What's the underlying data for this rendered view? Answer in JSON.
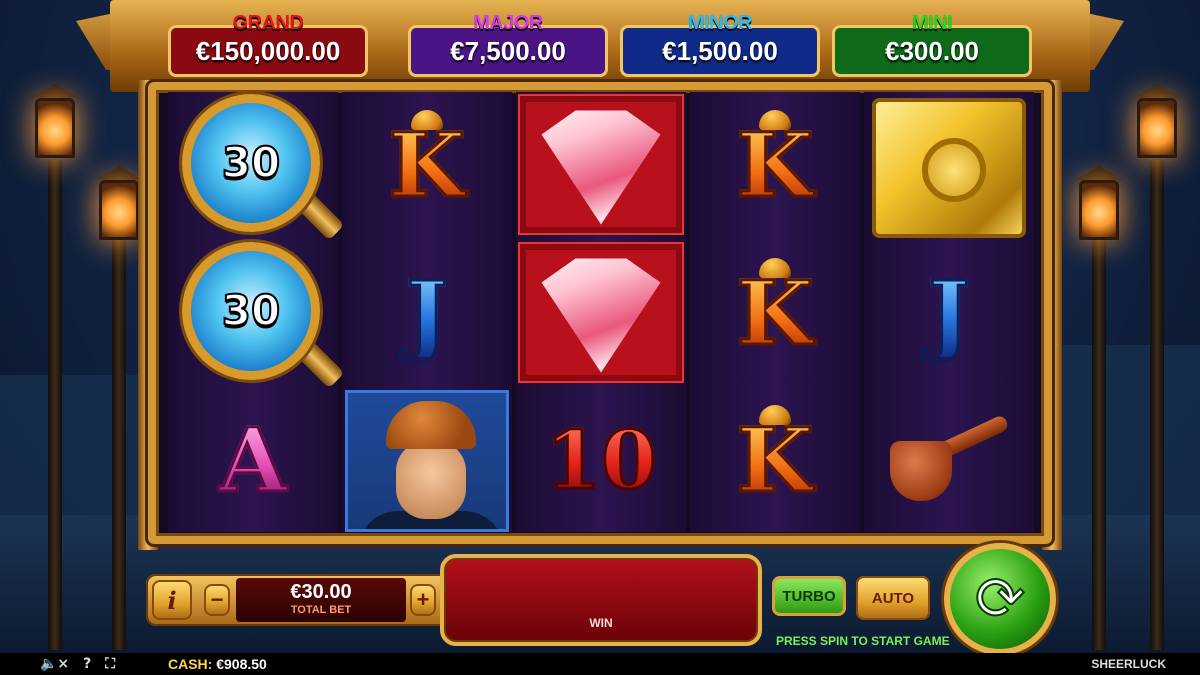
{
  "jackpots": [
    {
      "label": "GRAND",
      "value": "€150,000.00",
      "label_color": "#e4141c",
      "box_color": "#8a0a12"
    },
    {
      "label": "MAJOR",
      "value": "€7,500.00",
      "label_color": "#d33ae8",
      "box_color": "#4a1484"
    },
    {
      "label": "MINOR",
      "value": "€1,500.00",
      "label_color": "#2ab8f0",
      "box_color": "#102a8a"
    },
    {
      "label": "MINI",
      "value": "€300.00",
      "label_color": "#2ad41a",
      "box_color": "#0e6a18"
    }
  ],
  "reels": [
    [
      "magnifier-30",
      "magnifier-30",
      "A"
    ],
    [
      "K",
      "J",
      "detective"
    ],
    [
      "diamond",
      "diamond",
      "10"
    ],
    [
      "K",
      "K",
      "K"
    ],
    [
      "vault",
      "J",
      "pipe"
    ]
  ],
  "magnifier_values": [
    "30",
    "30"
  ],
  "symbols": {
    "K": "K",
    "J": "J",
    "A": "A",
    "ten": "10"
  },
  "controls": {
    "info_label": "i",
    "minus_label": "−",
    "plus_label": "+",
    "total_bet_value": "€30.00",
    "total_bet_label": "TOTAL BET",
    "win_label": "WIN",
    "turbo_label": "TURBO",
    "auto_label": "AUTO",
    "hint": "PRESS SPIN TO START GAME",
    "spin_glyph": "⟳"
  },
  "footer": {
    "sound_icon": "🔈×",
    "help_icon": "?",
    "fullscreen_icon": "⛶",
    "cash_label": "CASH:",
    "cash_value": "€908.50",
    "brand": "SHEERLUCK"
  }
}
